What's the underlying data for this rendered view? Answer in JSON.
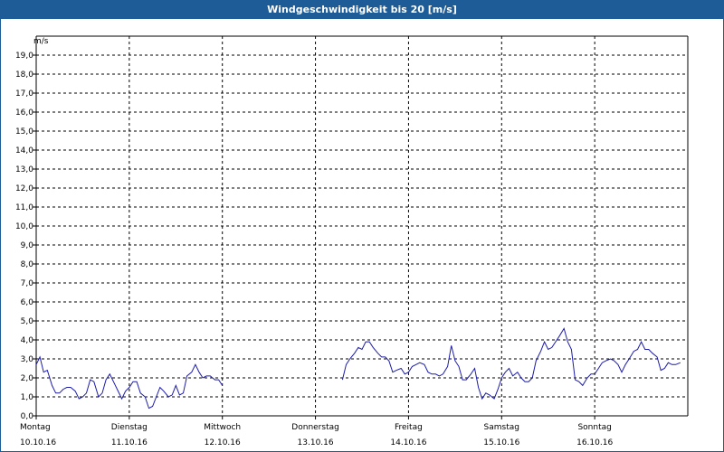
{
  "window": {
    "title": "Windgeschwindigkeit bis 20 [m/s]"
  },
  "chart_data": {
    "type": "line",
    "title": "Windgeschwindigkeit bis 20 [m/s]",
    "ylabel": "m/s",
    "xlabel": "",
    "ylim": [
      0,
      20
    ],
    "xlim": [
      0,
      7
    ],
    "grid": true,
    "colors": {
      "line": "#1c1caa",
      "grid": "#000000",
      "axis": "#000000"
    },
    "y_ticks": [
      "0,0",
      "1,0",
      "2,0",
      "3,0",
      "4,0",
      "5,0",
      "6,0",
      "7,0",
      "8,0",
      "9,0",
      "10,0",
      "11,0",
      "12,0",
      "13,0",
      "14,0",
      "15,0",
      "16,0",
      "17,0",
      "18,0",
      "19,0"
    ],
    "x_ticks": [
      {
        "day": "Montag",
        "date": "10.10.16"
      },
      {
        "day": "Dienstag",
        "date": "11.10.16"
      },
      {
        "day": "Mittwoch",
        "date": "12.10.16"
      },
      {
        "day": "Donnerstag",
        "date": "13.10.16"
      },
      {
        "day": "Freitag",
        "date": "14.10.16"
      },
      {
        "day": "Samstag",
        "date": "15.10.16"
      },
      {
        "day": "Sonntag",
        "date": "16.10.16"
      }
    ],
    "series": [
      {
        "segments": [
          [
            [
              0.0,
              2.7
            ],
            [
              0.04,
              3.1
            ],
            [
              0.08,
              2.3
            ],
            [
              0.12,
              2.4
            ],
            [
              0.17,
              1.6
            ],
            [
              0.21,
              1.2
            ],
            [
              0.25,
              1.2
            ],
            [
              0.29,
              1.4
            ],
            [
              0.33,
              1.5
            ],
            [
              0.37,
              1.5
            ],
            [
              0.42,
              1.3
            ],
            [
              0.46,
              0.9
            ],
            [
              0.5,
              1.0
            ],
            [
              0.54,
              1.2
            ],
            [
              0.58,
              1.9
            ],
            [
              0.62,
              1.8
            ],
            [
              0.67,
              1.0
            ],
            [
              0.71,
              1.2
            ],
            [
              0.75,
              1.9
            ],
            [
              0.79,
              2.2
            ],
            [
              0.83,
              1.8
            ],
            [
              0.87,
              1.4
            ],
            [
              0.92,
              0.9
            ],
            [
              0.96,
              1.3
            ],
            [
              1.0,
              1.5
            ],
            [
              1.04,
              1.8
            ],
            [
              1.08,
              1.8
            ],
            [
              1.12,
              1.2
            ],
            [
              1.17,
              1.0
            ],
            [
              1.21,
              0.4
            ],
            [
              1.25,
              0.5
            ],
            [
              1.29,
              1.0
            ],
            [
              1.33,
              1.5
            ],
            [
              1.37,
              1.3
            ],
            [
              1.42,
              1.0
            ],
            [
              1.46,
              1.1
            ],
            [
              1.5,
              1.6
            ],
            [
              1.54,
              1.1
            ],
            [
              1.58,
              1.2
            ],
            [
              1.62,
              2.1
            ],
            [
              1.67,
              2.3
            ],
            [
              1.71,
              2.7
            ],
            [
              1.75,
              2.3
            ],
            [
              1.79,
              2.0
            ],
            [
              1.83,
              2.1
            ],
            [
              1.87,
              2.1
            ],
            [
              1.92,
              1.9
            ],
            [
              1.96,
              1.9
            ],
            [
              2.0,
              1.6
            ]
          ],
          [
            [
              3.29,
              1.9
            ],
            [
              3.33,
              2.7
            ],
            [
              3.37,
              3.0
            ],
            [
              3.42,
              3.3
            ],
            [
              3.46,
              3.6
            ],
            [
              3.5,
              3.5
            ],
            [
              3.54,
              3.9
            ],
            [
              3.58,
              3.9
            ],
            [
              3.62,
              3.6
            ],
            [
              3.67,
              3.3
            ],
            [
              3.71,
              3.1
            ],
            [
              3.75,
              3.1
            ],
            [
              3.79,
              2.9
            ],
            [
              3.83,
              2.3
            ],
            [
              3.87,
              2.4
            ],
            [
              3.92,
              2.5
            ],
            [
              3.96,
              2.2
            ],
            [
              4.0,
              2.3
            ],
            [
              4.04,
              2.6
            ],
            [
              4.08,
              2.7
            ],
            [
              4.12,
              2.8
            ],
            [
              4.17,
              2.7
            ],
            [
              4.21,
              2.3
            ],
            [
              4.25,
              2.2
            ],
            [
              4.29,
              2.2
            ],
            [
              4.33,
              2.1
            ],
            [
              4.37,
              2.2
            ],
            [
              4.42,
              2.6
            ],
            [
              4.46,
              3.7
            ],
            [
              4.5,
              2.9
            ],
            [
              4.54,
              2.6
            ],
            [
              4.58,
              1.9
            ],
            [
              4.62,
              1.9
            ],
            [
              4.67,
              2.2
            ],
            [
              4.71,
              2.5
            ],
            [
              4.75,
              1.5
            ],
            [
              4.79,
              0.9
            ],
            [
              4.83,
              1.2
            ],
            [
              4.87,
              1.1
            ],
            [
              4.92,
              0.9
            ],
            [
              4.96,
              1.4
            ],
            [
              5.0,
              2.0
            ],
            [
              5.04,
              2.3
            ],
            [
              5.08,
              2.5
            ],
            [
              5.12,
              2.1
            ],
            [
              5.17,
              2.3
            ],
            [
              5.21,
              2.0
            ],
            [
              5.25,
              1.8
            ],
            [
              5.29,
              1.8
            ],
            [
              5.33,
              2.0
            ],
            [
              5.37,
              2.9
            ],
            [
              5.42,
              3.4
            ],
            [
              5.46,
              3.9
            ],
            [
              5.5,
              3.5
            ],
            [
              5.54,
              3.6
            ],
            [
              5.58,
              3.9
            ],
            [
              5.62,
              4.2
            ],
            [
              5.67,
              4.6
            ],
            [
              5.71,
              3.9
            ],
            [
              5.75,
              3.5
            ],
            [
              5.79,
              1.9
            ],
            [
              5.83,
              1.8
            ],
            [
              5.87,
              1.6
            ],
            [
              5.92,
              2.0
            ],
            [
              5.96,
              2.2
            ],
            [
              6.0,
              2.2
            ],
            [
              6.04,
              2.5
            ],
            [
              6.08,
              2.8
            ],
            [
              6.12,
              2.9
            ],
            [
              6.17,
              3.0
            ],
            [
              6.21,
              2.9
            ],
            [
              6.25,
              2.7
            ],
            [
              6.29,
              2.3
            ],
            [
              6.33,
              2.7
            ],
            [
              6.37,
              3.0
            ],
            [
              6.42,
              3.4
            ],
            [
              6.46,
              3.5
            ],
            [
              6.5,
              3.9
            ],
            [
              6.54,
              3.5
            ],
            [
              6.58,
              3.5
            ],
            [
              6.62,
              3.3
            ],
            [
              6.67,
              3.1
            ],
            [
              6.71,
              2.4
            ],
            [
              6.75,
              2.5
            ],
            [
              6.79,
              2.8
            ],
            [
              6.83,
              2.7
            ],
            [
              6.87,
              2.7
            ],
            [
              6.92,
              2.8
            ]
          ]
        ]
      }
    ]
  }
}
